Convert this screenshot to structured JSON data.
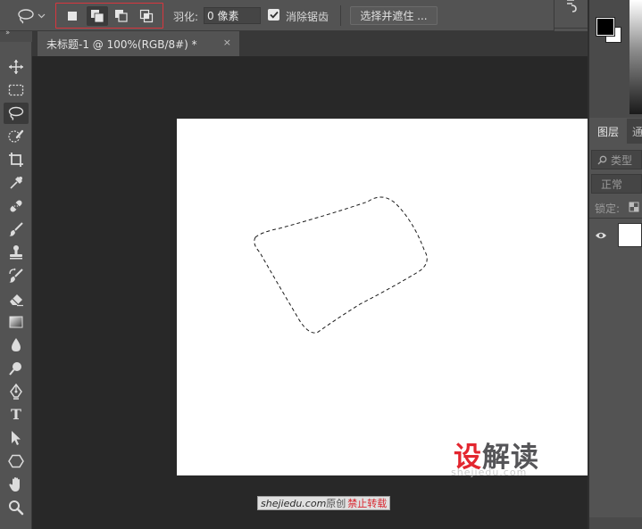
{
  "options_bar": {
    "feather_label": "羽化:",
    "feather_value": "0 像素",
    "antialias_label": "消除锯齿",
    "antialias_checked": true,
    "select_mask_label": "选择并遮住 ...",
    "selection_modes": [
      "new-selection",
      "add-to-selection",
      "subtract-from-selection",
      "intersect-with-selection"
    ],
    "active_mode": "add-to-selection"
  },
  "document": {
    "tab_title": "未标题-1 @ 100%(RGB/8#) *",
    "close_symbol": "×"
  },
  "tools": [
    "move",
    "marquee",
    "lasso",
    "quick-selection",
    "crop",
    "eyedropper",
    "healing-brush",
    "brush",
    "clone-stamp",
    "history-brush",
    "eraser",
    "gradient",
    "blur",
    "dodge",
    "pen",
    "type",
    "path-selection",
    "shape",
    "hand",
    "zoom"
  ],
  "active_tool": "lasso",
  "type_tool_glyph": "T",
  "layers_panel": {
    "tab_layers": "图层",
    "tab_channels": "通",
    "filter_label": "类型",
    "blend_mode": "正常",
    "lock_label": "锁定:"
  },
  "watermark": {
    "logo_red": "设",
    "logo_gray": "解读",
    "sub": "shejiedu.com",
    "badge_site": "shejiedu.com",
    "badge_orig": "原创",
    "badge_forbid": "禁止转载"
  },
  "colors": {
    "accent_red": "#d9363e",
    "panel_bg": "#535353",
    "workspace_bg": "#282828",
    "canvas_bg": "#ffffff"
  }
}
